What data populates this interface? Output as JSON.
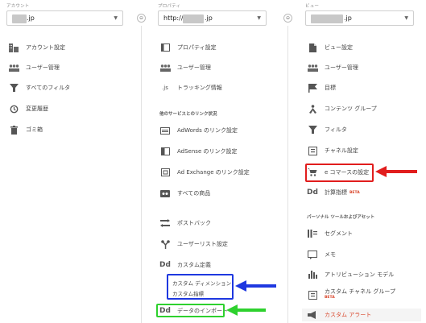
{
  "account": {
    "label": "アカウント",
    "selected_suffix": ".jp",
    "items": [
      {
        "label": "アカウント設定",
        "icon": "building-icon"
      },
      {
        "label": "ユーザー管理",
        "icon": "users-icon"
      },
      {
        "label": "すべてのフィルタ",
        "icon": "filter-icon"
      },
      {
        "label": "変更履歴",
        "icon": "history-icon"
      },
      {
        "label": "ゴミ箱",
        "icon": "trash-icon"
      }
    ]
  },
  "property": {
    "label": "プロパティ",
    "selected_prefix": "http://",
    "selected_suffix": ".jp",
    "items": [
      {
        "label": "プロパティ設定",
        "icon": "window-icon"
      },
      {
        "label": "ユーザー管理",
        "icon": "users-icon"
      },
      {
        "label": "トラッキング情報",
        "icon": "js-icon",
        "icon_text": ".js"
      }
    ],
    "section_heading": "他のサービスとのリンク状況",
    "link_items": [
      {
        "label": "AdWords のリンク設定",
        "icon": "adwords-icon"
      },
      {
        "label": "AdSense のリンク設定",
        "icon": "adsense-icon"
      },
      {
        "label": "Ad Exchange のリンク設定",
        "icon": "adexchange-icon"
      },
      {
        "label": "すべての商品",
        "icon": "products-icon"
      }
    ],
    "more_items": [
      {
        "label": "ポストバック",
        "icon": "postback-icon"
      },
      {
        "label": "ユーザーリスト設定",
        "icon": "userlist-icon"
      },
      {
        "label": "カスタム定義",
        "icon": "dd-icon",
        "icon_text": "Dd"
      }
    ],
    "custom_sub": [
      {
        "label": "カスタム ディメンション"
      },
      {
        "label": "カスタム指標"
      }
    ],
    "data_import": {
      "label": "データのインポート",
      "icon_text": "Dd"
    }
  },
  "view": {
    "label": "ビュー",
    "selected_suffix": ".jp",
    "items": [
      {
        "label": "ビュー設定",
        "icon": "document-icon"
      },
      {
        "label": "ユーザー管理",
        "icon": "users-icon"
      },
      {
        "label": "目標",
        "icon": "flag-icon"
      },
      {
        "label": "コンテンツ グループ",
        "icon": "person-icon"
      },
      {
        "label": "フィルタ",
        "icon": "filter-icon"
      },
      {
        "label": "チャネル設定",
        "icon": "channel-icon"
      },
      {
        "label": "e コマースの設定",
        "icon": "cart-icon"
      },
      {
        "label": "計算指標",
        "icon": "dd-icon",
        "icon_text": "Dd",
        "badge": "BETA"
      }
    ],
    "section_heading": "パーソナル ツールおよびアセット",
    "personal_items": [
      {
        "label": "セグメント",
        "icon": "segment-icon"
      },
      {
        "label": "メモ",
        "icon": "note-icon"
      },
      {
        "label": "アトリビューション モデル",
        "icon": "bars-icon"
      },
      {
        "label": "カスタム チャネル グループ",
        "icon": "channel-group-icon",
        "badge": "BETA"
      },
      {
        "label": "カスタム アラート",
        "icon": "megaphone-icon"
      }
    ]
  },
  "colors": {
    "highlight_red": "#e11d1d",
    "highlight_blue": "#1e38e0",
    "highlight_green": "#2ed12e",
    "beta": "#d9482e"
  }
}
